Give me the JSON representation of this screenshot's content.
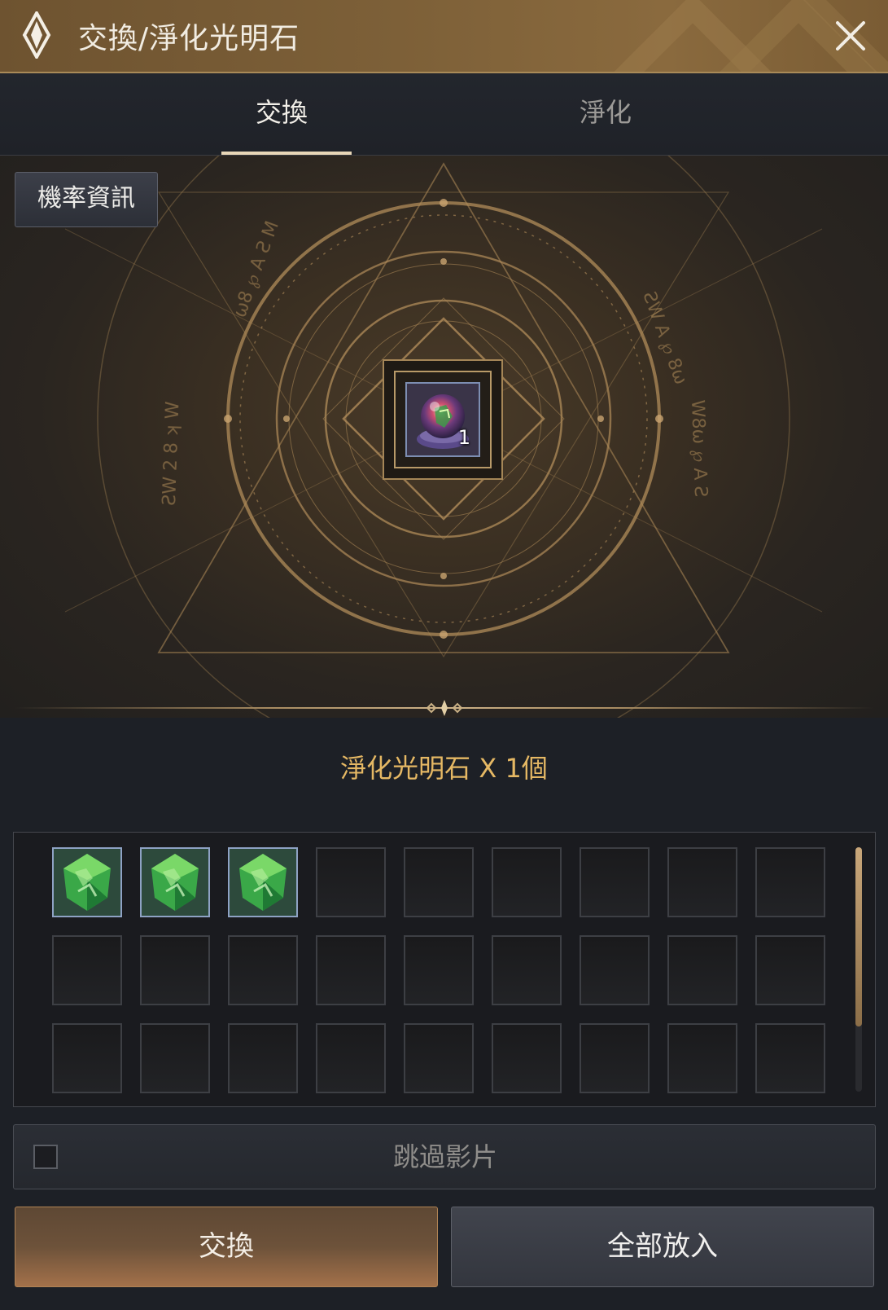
{
  "window": {
    "title": "交換/淨化光明石"
  },
  "tabs": [
    {
      "label": "交換",
      "active": true
    },
    {
      "label": "淨化",
      "active": false
    }
  ],
  "stage": {
    "probability_button": "機率資訊",
    "center_item": {
      "icon": "purified-light-stone-icon",
      "quantity": "1"
    }
  },
  "result_text": "淨化光明石 X 1個",
  "inventory": {
    "rows": 3,
    "columns": 9,
    "filled_slots": [
      {
        "icon": "green-light-stone-icon"
      },
      {
        "icon": "green-light-stone-icon"
      },
      {
        "icon": "green-light-stone-icon"
      }
    ]
  },
  "skip_video": {
    "label": "跳過影片",
    "checked": false
  },
  "buttons": {
    "exchange": "交換",
    "put_all": "全部放入"
  },
  "colors": {
    "title_bar": "#7d6038",
    "result_text": "#e5b864",
    "exchange_button": "#a3714a"
  }
}
